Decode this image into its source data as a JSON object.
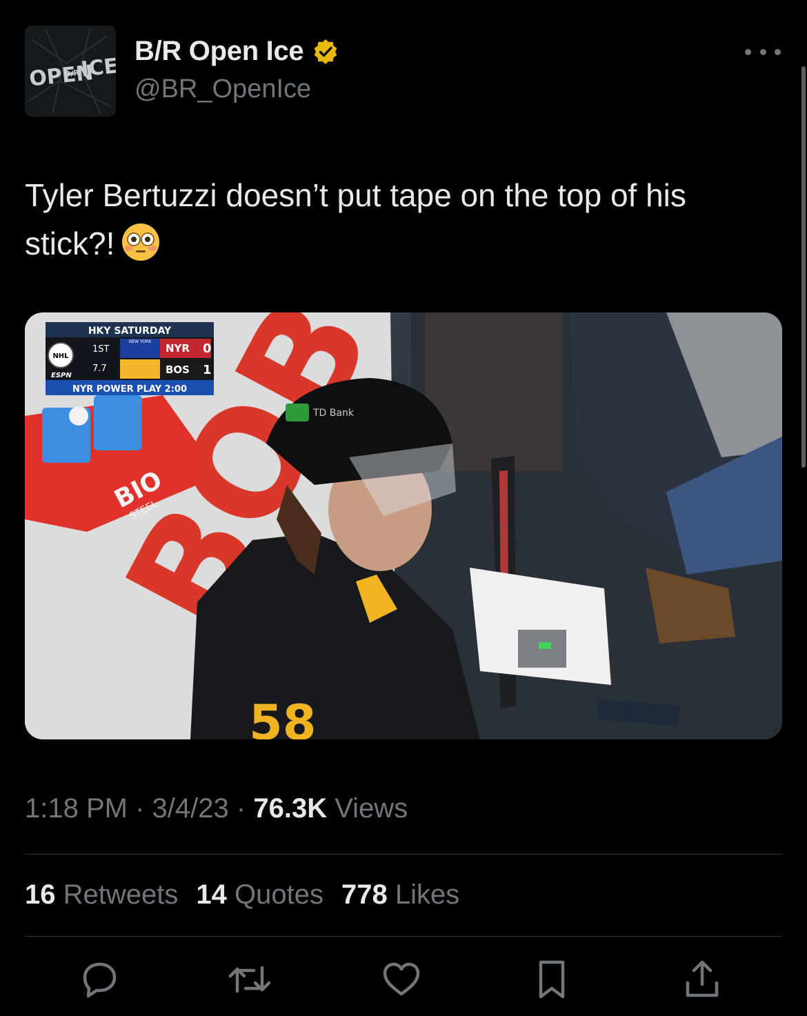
{
  "author": {
    "avatar_text_left": "OPEN",
    "avatar_text_mid": "B/R",
    "avatar_text_right": "ICE",
    "name": "B/R Open Ice",
    "handle": "@BR_OpenIce",
    "verified_color": "#e8b80c"
  },
  "tweet": {
    "text": "Tyler Bertuzzi doesn’t put tape on the top of his stick?!",
    "emoji": "flushed-face"
  },
  "media": {
    "scorebug": {
      "header": "HKY SATURDAY",
      "period": "1ST",
      "clock": "7.7",
      "network": "ESPN",
      "team1_small": "NEW YORK",
      "team1": "NYR",
      "score1": "0",
      "team2": "BOS",
      "score2": "1",
      "situation": "NYR POWER PLAY 2:00"
    },
    "boards_text": "BOB'S",
    "box_brand": "BIO",
    "box_brand_sub": "STEEL",
    "sponsor_patch": "TD Bank",
    "jersey_number": "58"
  },
  "meta": {
    "time": "1:18 PM",
    "sep1": "·",
    "date": "3/4/23",
    "sep2": "·",
    "views_count": "76.3K",
    "views_label": "Views"
  },
  "stats": {
    "retweets_count": "16",
    "retweets_label": "Retweets",
    "quotes_count": "14",
    "quotes_label": "Quotes",
    "likes_count": "778",
    "likes_label": "Likes"
  },
  "actions": [
    "reply-icon",
    "retweet-icon",
    "like-icon",
    "bookmark-icon",
    "share-icon"
  ],
  "colors": {
    "background": "#000000",
    "text_primary": "#e7e9ea",
    "text_secondary": "#71767b",
    "divider": "#2f3336"
  }
}
